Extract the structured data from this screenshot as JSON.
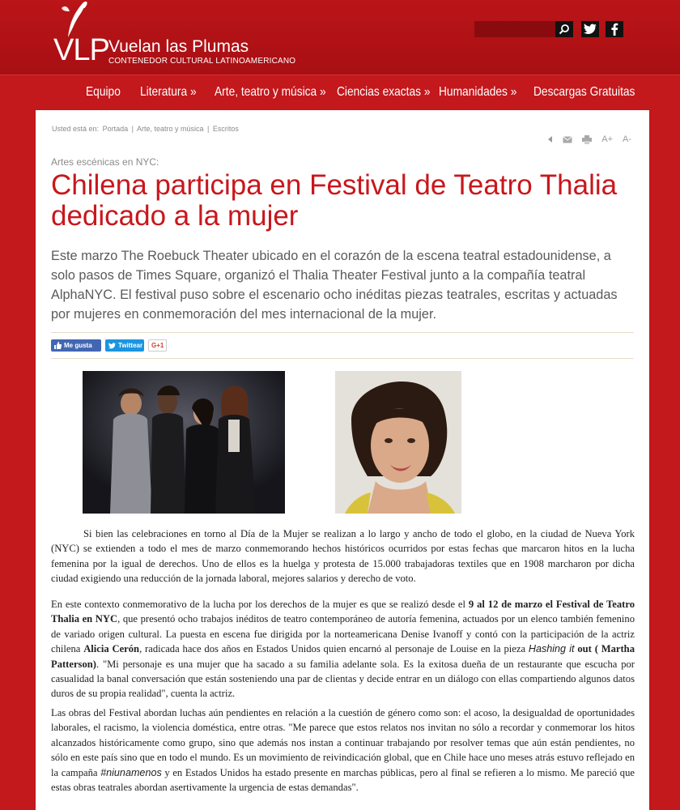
{
  "header": {
    "logo_mark": "VLP",
    "site_name": "Vuelan las Plumas",
    "tagline": "CONTENEDOR CULTURAL LATINOAMERICANO",
    "search_placeholder": ""
  },
  "nav": {
    "items": [
      "Equipo",
      "Literatura »",
      "Arte, teatro y música »",
      "Ciencias exactas »",
      "Humanidades »",
      "Descargas Gratuitas"
    ]
  },
  "breadcrumb": {
    "prefix": "Usted está en:",
    "items": [
      "Portada",
      "|",
      "Arte, teatro y música",
      "|",
      "Escritos"
    ]
  },
  "tools": {
    "font_increase": "A+",
    "font_decrease": "A-"
  },
  "article": {
    "kicker": "Artes escénicas en NYC:",
    "title": "Chilena participa en Festival de Teatro Thalia dedicado a la mujer",
    "lead": "Este marzo The Roebuck Theater ubicado en el corazón de la escena teatral estadounidense, a solo pasos de Times Square, organizó el Thalia Theater Festival junto a la compañía teatral AlphaNYC. El festival puso sobre el escenario ocho inéditas piezas teatrales, escritas y actuadas por mujeres en conmemoración del mes internacional de la mujer.",
    "share": {
      "facebook": "Me gusta",
      "twitter": "Twittear",
      "google": "G+1"
    },
    "p1": "Si bien las celebraciones en torno al Día de la Mujer se realizan a lo largo y ancho de todo el globo, en la ciudad de Nueva York (NYC) se extienden a todo el mes de marzo conmemorando hechos históricos ocurridos por estas fechas que marcaron hitos en la lucha femenina por la igual de derechos. Uno de ellos es la huelga y protesta de 15.000 trabajadoras textiles que en 1908 marcharon por dicha ciudad exigiendo una reducción de la jornada laboral, mejores salarios y derecho de voto.",
    "p2_a": "En este contexto conmemorativo de la lucha por los derechos de la mujer es que se realizó desde el ",
    "p2_b": "9 al 12 de marzo el Festival de Teatro Thalia en NYC",
    "p2_c": ", que presentó ocho trabajos inéditos de teatro contemporáneo de autoría femenina, actuados por un elenco también femenino de variado origen cultural. La puesta en escena fue dirigida por la norteamericana Denise Ivanoff y contó con la participación de la actriz chilena ",
    "p2_d": "Alicia Cerón",
    "p2_e": ", radicada hace dos años en Estados Unidos quien encarnó al personaje de Louise en la pieza ",
    "p2_f": "Hashing it",
    "p2_g": " out",
    "p2_h": " ( Martha Patterson)",
    "p2_i": ". \"Mi personaje es una mujer que ha sacado a su familia adelante sola. Es la exitosa dueña de un restaurante que escucha por casualidad la banal conversación que están sosteniendo una par de clientas y decide entrar en un diálogo con ellas compartiendo algunos datos duros de su propia realidad\", cuenta la actriz.",
    "p3_a": "Las obras del Festival abordan luchas aún pendientes en relación a la cuestión de género como son: el acoso, la desigualdad de oportunidades laborales, el racismo, la violencia doméstica, entre otras. \"Me parece que estos relatos nos invitan no sólo a recordar y conmemorar los hitos alcanzados históricamente como grupo, sino que además nos instan a continuar trabajando por resolver temas que aún están pendientes, no sólo en este país sino que en todo el mundo. Es un movimiento de reivindicación global, que en Chile hace uno meses atrás estuvo reflejado en la campaña ",
    "p3_b": "#niunamenos",
    "p3_c": " y en Estados Unidos ha estado presente en marchas públicas, pero al final se refieren a lo mismo. Me pareció que estas obras teatrales abordan asertivamente la urgencia de estas demandas\"."
  },
  "colors": {
    "brand_red": "#c3181c",
    "title_red": "#c8171c"
  }
}
